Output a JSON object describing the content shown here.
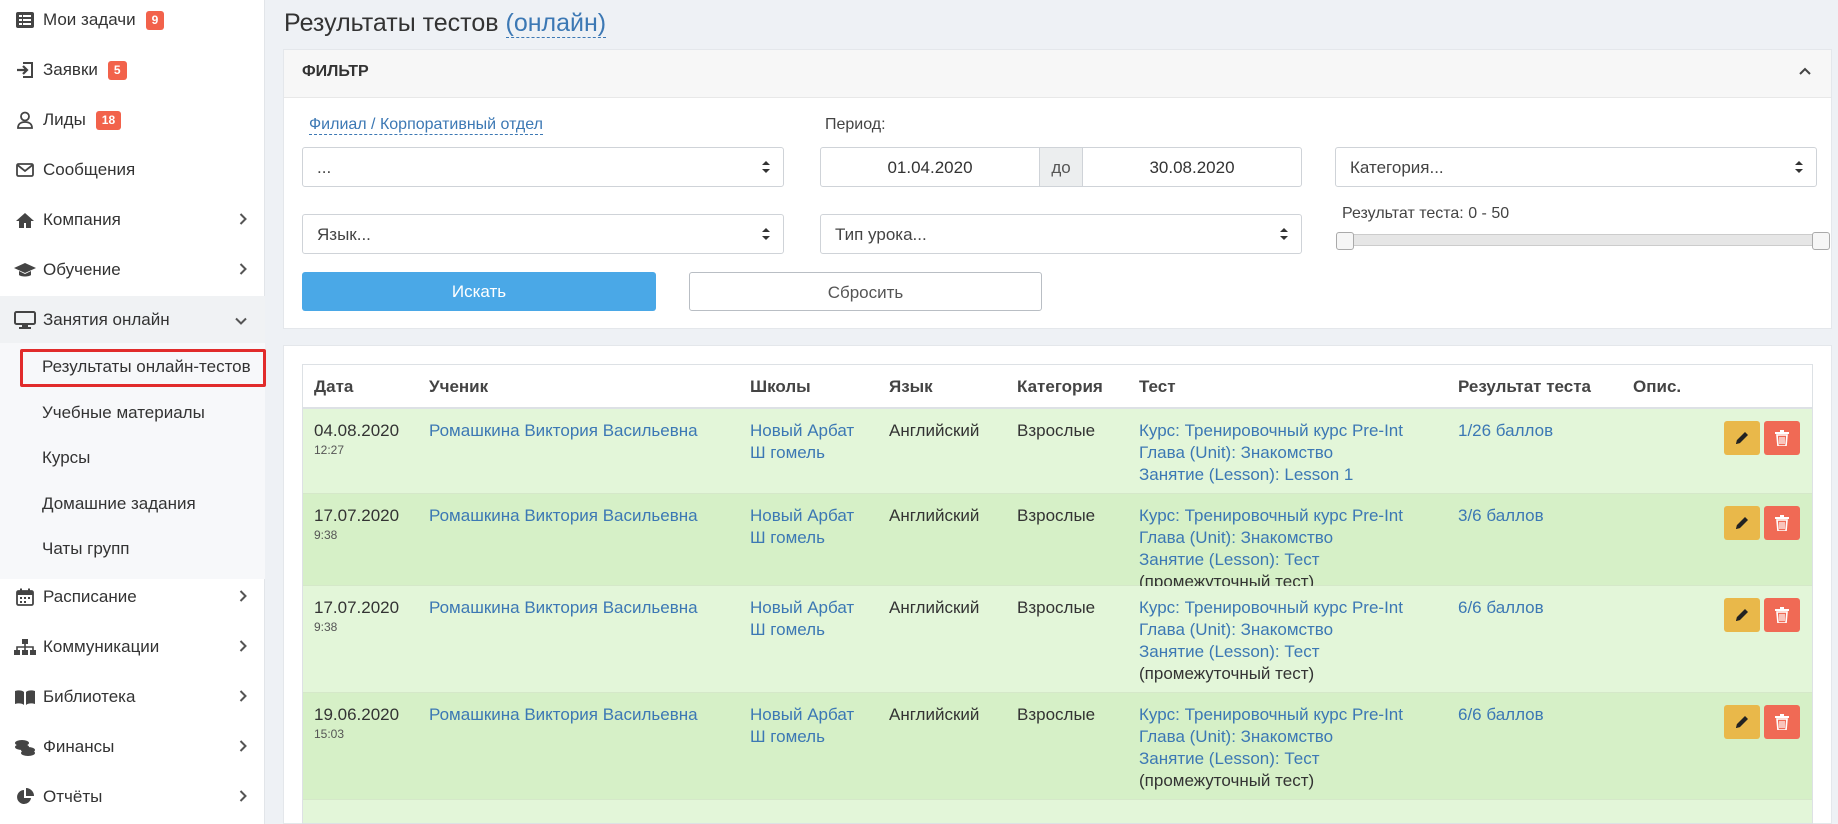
{
  "sidebar": {
    "items": [
      {
        "label": "Мои задачи",
        "badge": "9"
      },
      {
        "label": "Заявки",
        "badge": "5"
      },
      {
        "label": "Лиды",
        "badge": "18"
      },
      {
        "label": "Сообщения"
      },
      {
        "label": "Компания"
      },
      {
        "label": "Обучение"
      },
      {
        "label": "Занятия онлайн"
      },
      {
        "label": "Расписание"
      },
      {
        "label": "Коммуникации"
      },
      {
        "label": "Библиотека"
      },
      {
        "label": "Финансы"
      },
      {
        "label": "Отчёты"
      }
    ],
    "sub_items": [
      {
        "label": "Результаты онлайн-тестов"
      },
      {
        "label": "Учебные материалы"
      },
      {
        "label": "Курсы"
      },
      {
        "label": "Домашние задания"
      },
      {
        "label": "Чаты групп"
      }
    ]
  },
  "page": {
    "title": "Результаты тестов",
    "title_link": "(онлайн)"
  },
  "filter": {
    "header": "ФИЛЬТР",
    "branch_label": "Филиал / Корпоративный отдел",
    "branch_value": "...",
    "period_label": "Период:",
    "date_from": "01.04.2020",
    "date_sep": "до",
    "date_to": "30.08.2020",
    "category_placeholder": "Категория...",
    "language_placeholder": "Язык...",
    "lesson_type_placeholder": "Тип урока...",
    "result_label": "Результат теста: 0 - 50",
    "search_button": "Искать",
    "reset_button": "Сбросить"
  },
  "table": {
    "columns": [
      "Дата",
      "Ученик",
      "Школы",
      "Язык",
      "Категория",
      "Тест",
      "Результат теста",
      "Опис."
    ],
    "rows": [
      {
        "date": "04.08.2020",
        "time": "12:27",
        "student": "Ромашкина Виктория Васильевна",
        "school1": "Новый Арбат",
        "school2": "Ш гомель",
        "language": "Английский",
        "category": "Взрослые",
        "test1": "Курс: Тренировочный курс Pre-Int",
        "test2": "Глава (Unit): Знакомство",
        "test3": "Занятие (Lesson): Lesson 1",
        "test4": "",
        "result": "1/26 баллов"
      },
      {
        "date": "17.07.2020",
        "time": "9:38",
        "student": "Ромашкина Виктория Васильевна",
        "school1": "Новый Арбат",
        "school2": "Ш гомель",
        "language": "Английский",
        "category": "Взрослые",
        "test1": "Курс: Тренировочный курс Pre-Int",
        "test2": "Глава (Unit): Знакомство",
        "test3": "Занятие (Lesson): Тест",
        "test4": "(промежуточный тест)",
        "result": "3/6 баллов"
      },
      {
        "date": "17.07.2020",
        "time": "9:38",
        "student": "Ромашкина Виктория Васильевна",
        "school1": "Новый Арбат",
        "school2": "Ш гомель",
        "language": "Английский",
        "category": "Взрослые",
        "test1": "Курс: Тренировочный курс Pre-Int",
        "test2": "Глава (Unit): Знакомство",
        "test3": "Занятие (Lesson): Тест",
        "test4": "(промежуточный тест)",
        "result": "6/6 баллов"
      },
      {
        "date": "19.06.2020",
        "time": "15:03",
        "student": "Ромашкина Виктория Васильевна",
        "school1": "Новый Арбат",
        "school2": "Ш гомель",
        "language": "Английский",
        "category": "Взрослые",
        "test1": "Курс: Тренировочный курс Pre-Int",
        "test2": "Глава (Unit): Знакомство",
        "test3": "Занятие (Lesson): Тест",
        "test4": "(промежуточный тест)",
        "result": "6/6 баллов"
      }
    ]
  },
  "colors": {
    "accent": "#3c78b4",
    "primary_button": "#4aa8e7",
    "badge": "#f2624b",
    "row_green": "#d6f0c7",
    "edit": "#e9b84a",
    "delete": "#f06a55",
    "highlight_border": "#e12b2b"
  },
  "icons": {
    "sidebar": [
      "tasks-list-icon",
      "sign-in-icon",
      "user-icon",
      "envelope-icon",
      "home-icon",
      "graduation-cap-icon",
      "monitor-icon",
      "calendar-icon",
      "sitemap-icon",
      "book-icon",
      "coins-icon",
      "pie-chart-icon"
    ],
    "actions": [
      "pencil-icon",
      "trash-icon"
    ]
  }
}
